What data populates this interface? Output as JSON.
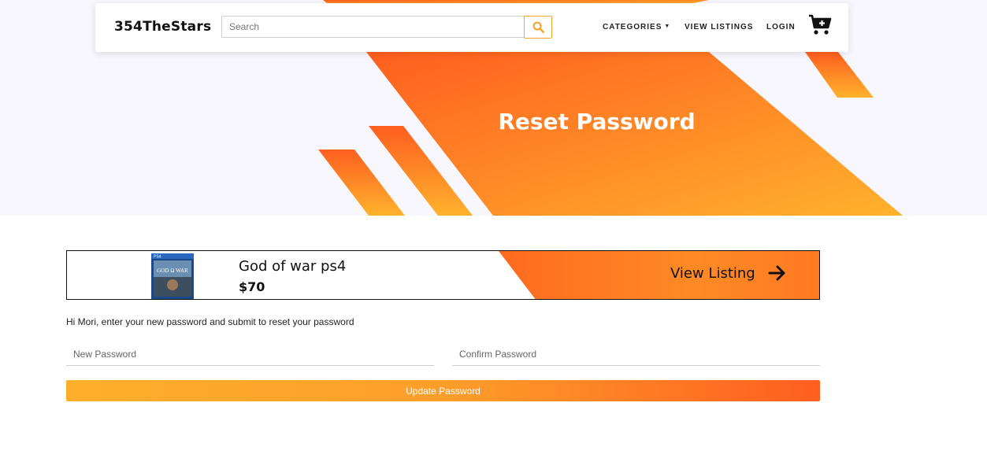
{
  "navbar": {
    "brand": "354TheStars",
    "search": {
      "placeholder": "Search",
      "value": "",
      "button_icon": "search-icon"
    },
    "links": {
      "categories": "CATEGORIES",
      "view_listings": "VIEW LISTINGS",
      "login": "LOGIN"
    },
    "cart_icon": "cart-plus-icon"
  },
  "hero": {
    "title": "Reset Password"
  },
  "listing": {
    "title": "God of war ps4",
    "price": "$70",
    "view_label": "View Listing",
    "arrow_icon": "arrow-right-icon",
    "thumbnail": "game-cover-image"
  },
  "form": {
    "message": "Hi Mori, enter your new password and submit to reset your password",
    "new_password_placeholder": "New Password",
    "confirm_password_placeholder": "Confirm Password",
    "submit_label": "Update Password"
  },
  "colors": {
    "accent_orange": "#ff6b1f",
    "accent_yellow": "#ffaf2c",
    "hero_bg": "#f7f7fd"
  }
}
